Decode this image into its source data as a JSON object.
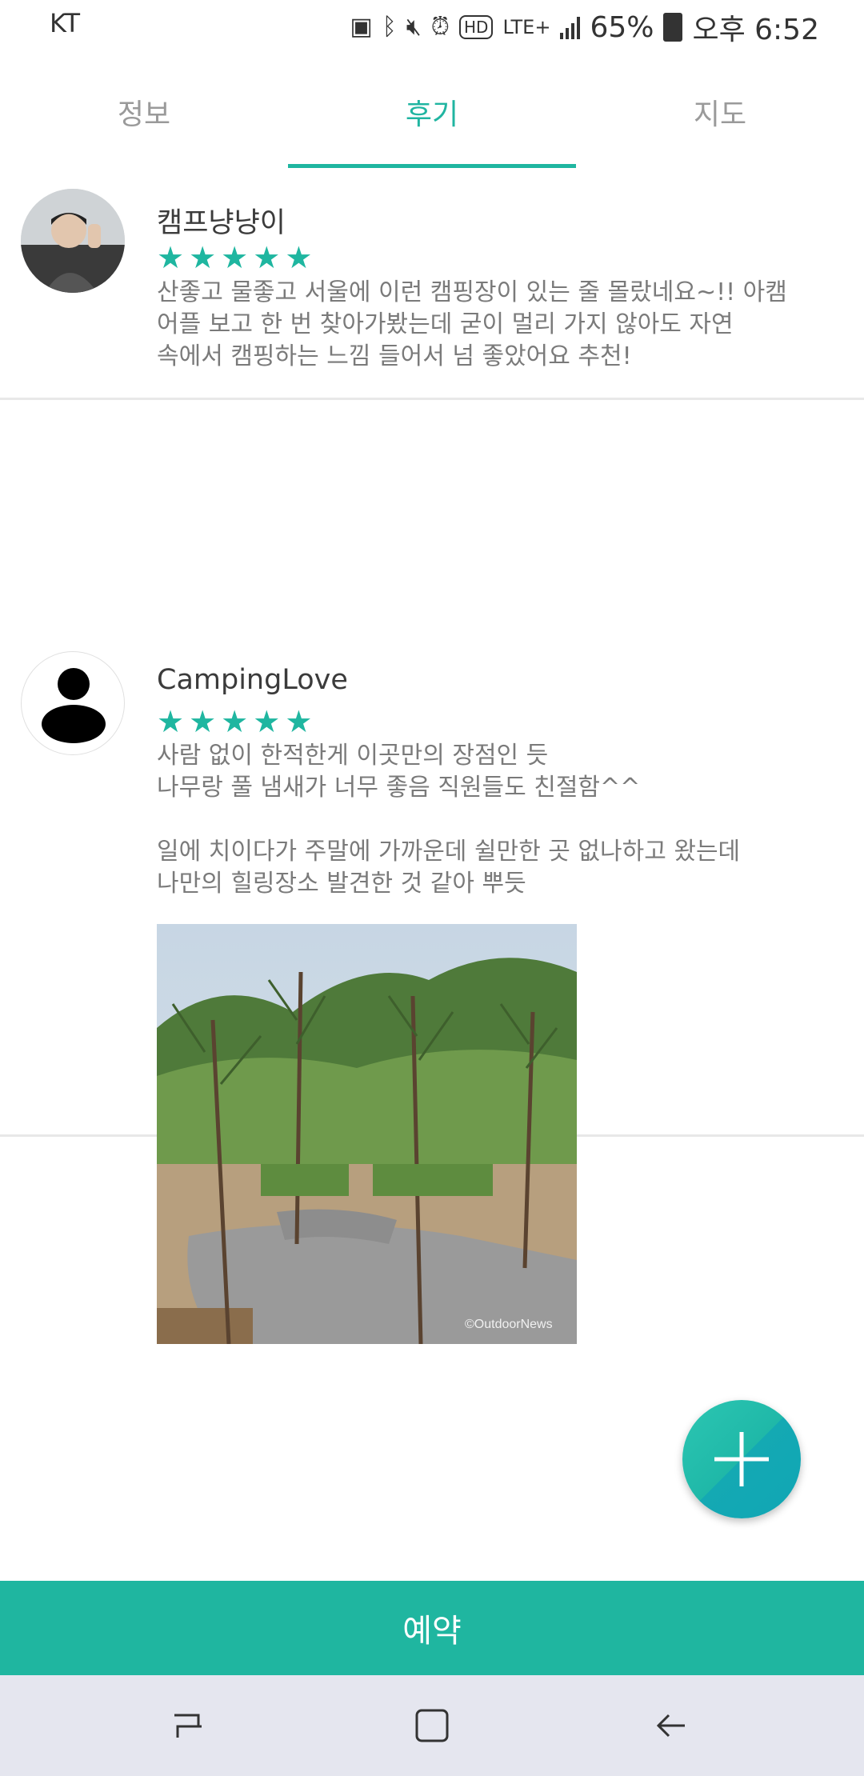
{
  "status_bar": {
    "carrier": "KT",
    "battery_percent": "65%",
    "time": "오후 6:52",
    "network": "LTE+"
  },
  "tabs": [
    {
      "label": "정보",
      "active": false
    },
    {
      "label": "후기",
      "active": true
    },
    {
      "label": "지도",
      "active": false
    }
  ],
  "reviews": [
    {
      "user": "캠프냥냥이",
      "rating": 5,
      "text": "산좋고 물좋고 서울에 이런 캠핑장이 있는 줄 몰랐네요~!! 아캠\n어플 보고 한 번 찾아가봤는데 굳이 멀리 가지 않아도 자연\n속에서 캠핑하는 느낌 들어서 넘 좋았어요 추천!"
    },
    {
      "user": "CampingLove",
      "rating": 5,
      "text": "사람 없이 한적한게 이곳만의 장점인 듯\n나무랑 풀 냄새가 너무 좋음 직원들도 친절함^^\n\n일에 치이다가 주말에 가까운데 쉴만한 곳 없나하고 왔는데\n나만의 힐링장소 발견한 것 같아 뿌듯",
      "photo_watermark": "©OutdoorNews"
    }
  ],
  "book_button": "예약",
  "colors": {
    "accent": "#1fb6a0",
    "tab_inactive": "#9a9a9a",
    "text_primary": "#3b3b3b",
    "text_secondary": "#7a7a7a",
    "nav_bg": "#e5e6ef"
  },
  "icons": [
    "plus-icon",
    "recent-apps-icon",
    "home-icon",
    "back-icon",
    "star-icon",
    "default-avatar-icon"
  ]
}
